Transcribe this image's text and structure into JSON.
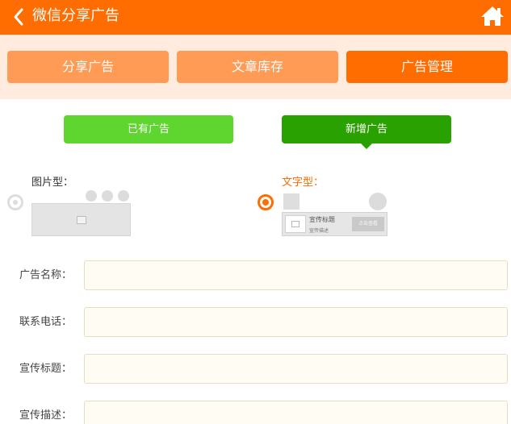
{
  "header": {
    "title": "微信分享广告"
  },
  "tabs": [
    {
      "label": "分享广告"
    },
    {
      "label": "文章库存"
    },
    {
      "label": "广告管理"
    }
  ],
  "subtabs": [
    {
      "label": "已有广告"
    },
    {
      "label": "新增广告"
    }
  ],
  "types": {
    "image": {
      "label": "图片型："
    },
    "text": {
      "label": "文字型：",
      "card_title": "宣传标题",
      "card_desc": "宣传描述",
      "card_button": "点击查看"
    }
  },
  "form": {
    "fields": [
      {
        "label": "广告名称：",
        "value": ""
      },
      {
        "label": "联系电话：",
        "value": ""
      },
      {
        "label": "宣传标题：",
        "value": ""
      },
      {
        "label": "宣传描述：",
        "value": ""
      }
    ]
  },
  "colors": {
    "brand": "#ff6c00",
    "tab_inactive": "#ff9b55",
    "green_light": "#5fd52f",
    "green_dark": "#29a100"
  }
}
